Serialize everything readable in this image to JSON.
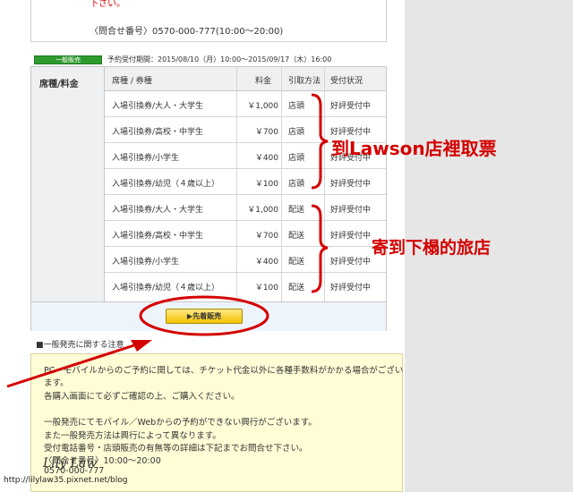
{
  "top": {
    "red_text": "下さい。",
    "contact": "〈問合せ番号〉0570-000-777(10:00～20:00)"
  },
  "sale": {
    "badge": "一般販売",
    "period": "予約受付期間：2015/08/10（月）10:00～2015/09/17（木）16:00"
  },
  "table": {
    "left_header": "席種/料金",
    "headers": [
      "席種 / 券種",
      "料金",
      "引取方法",
      "受付状況"
    ],
    "rows": [
      {
        "ticket": "入場引換券/大人・大学生",
        "price": "￥1,000",
        "method": "店頭",
        "status": "好評受付中"
      },
      {
        "ticket": "入場引換券/高校・中学生",
        "price": "￥700",
        "method": "店頭",
        "status": "好評受付中"
      },
      {
        "ticket": "入場引換券/小学生",
        "price": "￥400",
        "method": "店頭",
        "status": "好評受付中"
      },
      {
        "ticket": "入場引換券/幼児（４歳以上）",
        "price": "￥100",
        "method": "店頭",
        "status": "好評受付中"
      },
      {
        "ticket": "入場引換券/大人・大学生",
        "price": "￥1,000",
        "method": "配送",
        "status": "好評受付中"
      },
      {
        "ticket": "入場引換券/高校・中学生",
        "price": "￥700",
        "method": "配送",
        "status": "好評受付中"
      },
      {
        "ticket": "入場引換券/小学生",
        "price": "￥400",
        "method": "配送",
        "status": "好評受付中"
      },
      {
        "ticket": "入場引換券/幼児（４歳以上）",
        "price": "￥100",
        "method": "配送",
        "status": "好評受付中"
      }
    ]
  },
  "buy_button": "▶先着販売",
  "notice": {
    "title": "■一般発売に関する注意",
    "lines": [
      "PC・モバイルからのご予約に関しては、チケット代金以外に各種手数料がかかる場合がござい",
      "ます。",
      "各購入画面にて必ずご確認の上、ご購入ください。",
      "",
      "一般発売にてモバイル／Webからの予約ができない興行がございます。",
      "また一般発売方法は興行によって異なります。",
      "受付電話番号・店頭販売の有無等の詳細は下記までお問合せ下さい。",
      "〈問合せ番号〉10:00～20:00",
      "0570-000-777"
    ]
  },
  "annotations": {
    "lawson": "到Lawson店裡取票",
    "hotel": "寄到下榻的旅店",
    "color": "#d40000"
  },
  "watermark": {
    "signature": "Lily Law",
    "url": "http://lilylaw35.pixnet.net/blog"
  }
}
